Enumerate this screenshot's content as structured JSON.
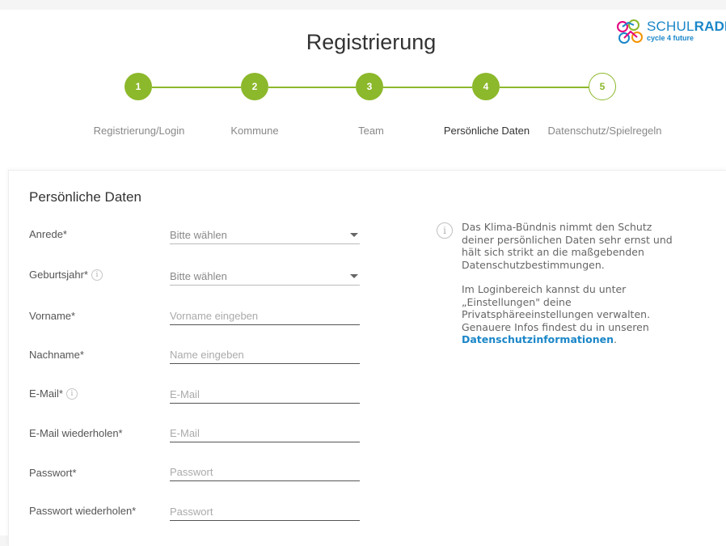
{
  "logo": {
    "title_part1": "SCHUL",
    "title_part2": "RADELN",
    "subtitle": "cycle 4 future"
  },
  "page_title": "Registrierung",
  "steps": [
    {
      "number": "1",
      "label": "Registrierung/Login",
      "state": "done"
    },
    {
      "number": "2",
      "label": "Kommune",
      "state": "done"
    },
    {
      "number": "3",
      "label": "Team",
      "state": "done"
    },
    {
      "number": "4",
      "label": "Persönliche Daten",
      "state": "active"
    },
    {
      "number": "5",
      "label": "Datenschutz/Spielregeln",
      "state": "open"
    }
  ],
  "form": {
    "section_title": "Persönliche Daten",
    "fields": {
      "salutation": {
        "label": "Anrede*",
        "value": "Bitte wählen"
      },
      "birth_year": {
        "label": "Geburtsjahr*",
        "value": "Bitte wählen"
      },
      "first_name": {
        "label": "Vorname*",
        "placeholder": "Vorname eingeben"
      },
      "last_name": {
        "label": "Nachname*",
        "placeholder": "Name eingeben"
      },
      "email": {
        "label": "E-Mail*",
        "placeholder": "E-Mail"
      },
      "email_repeat": {
        "label": "E-Mail wiederholen*",
        "placeholder": "E-Mail"
      },
      "password": {
        "label": "Passwort*",
        "placeholder": "Passwort"
      },
      "password_repeat": {
        "label": "Passwort wiederholen*",
        "placeholder": "Passwort"
      }
    }
  },
  "info": {
    "paragraph1": "Das Klima-Bündnis nimmt den Schutz deiner persönlichen Daten sehr ernst und hält sich strikt an die maßgebenden Datenschutzbestimmungen.",
    "paragraph2": "Im Loginbereich kannst du unter „Einstellungen\" deine Privatsphäreeinstellungen verwalten. Genauere Infos findest du in unseren",
    "link": "Datenschutzinformationen",
    "suffix": "."
  },
  "colors": {
    "accent_green": "#8cb82b",
    "link_blue": "#1a86c8",
    "text_dark": "#333333"
  }
}
